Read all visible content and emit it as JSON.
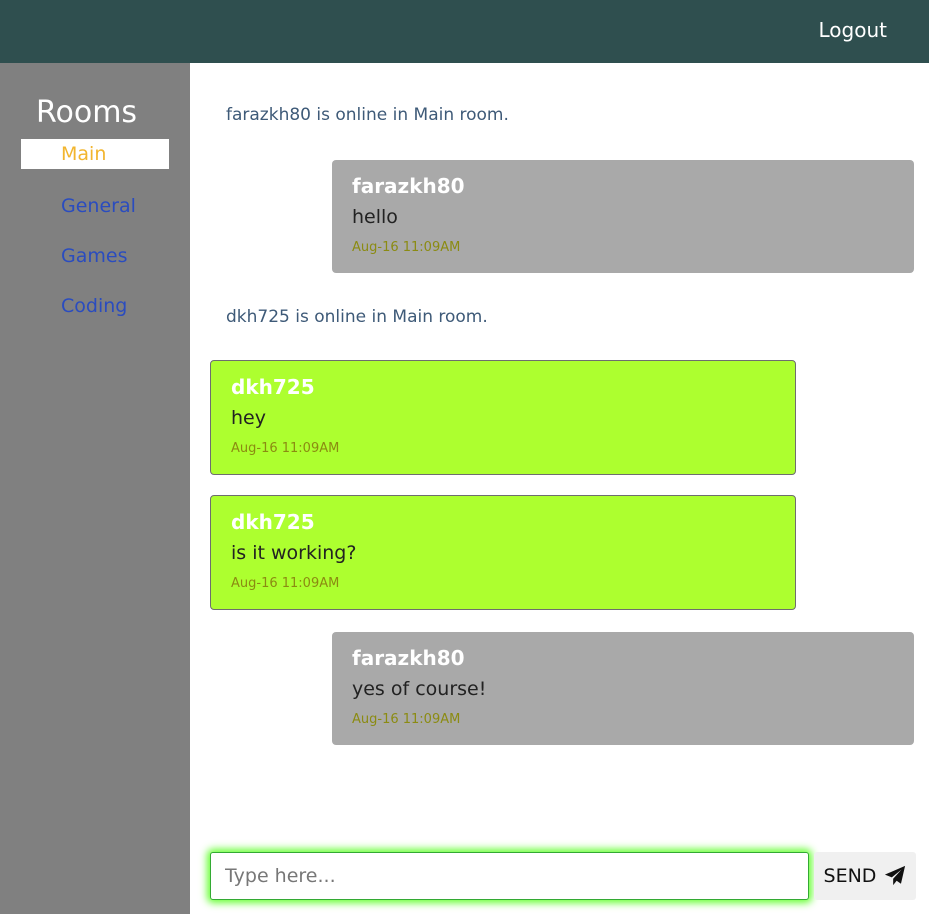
{
  "navbar": {
    "logout_label": "Logout"
  },
  "sidebar": {
    "title": "Rooms",
    "rooms": [
      {
        "label": "Main",
        "active": true
      },
      {
        "label": "General",
        "active": false
      },
      {
        "label": "Games",
        "active": false
      },
      {
        "label": "Coding",
        "active": false
      }
    ]
  },
  "chat": {
    "status_1": "farazkh80 is online in Main room.",
    "status_2": "dkh725 is online in Main room.",
    "messages": [
      {
        "user": "farazkh80",
        "text": "hello",
        "time": "Aug-16 11:09AM",
        "side": "other"
      },
      {
        "user": "dkh725",
        "text": "hey",
        "time": "Aug-16 11:09AM",
        "side": "mine"
      },
      {
        "user": "dkh725",
        "text": "is it working?",
        "time": "Aug-16 11:09AM",
        "side": "mine"
      },
      {
        "user": "farazkh80",
        "text": "yes of course!",
        "time": "Aug-16 11:09AM",
        "side": "other"
      }
    ]
  },
  "composer": {
    "placeholder": "Type here...",
    "value": "",
    "send_label": "SEND",
    "send_icon": "paper-plane-icon"
  },
  "colors": {
    "navbar": "#2f4f4f",
    "sidebar": "#808080",
    "own_message": "#adff2f",
    "other_message": "#a9a9a9",
    "active_room": "#f2b52e",
    "room_link": "#2a4cbf"
  }
}
